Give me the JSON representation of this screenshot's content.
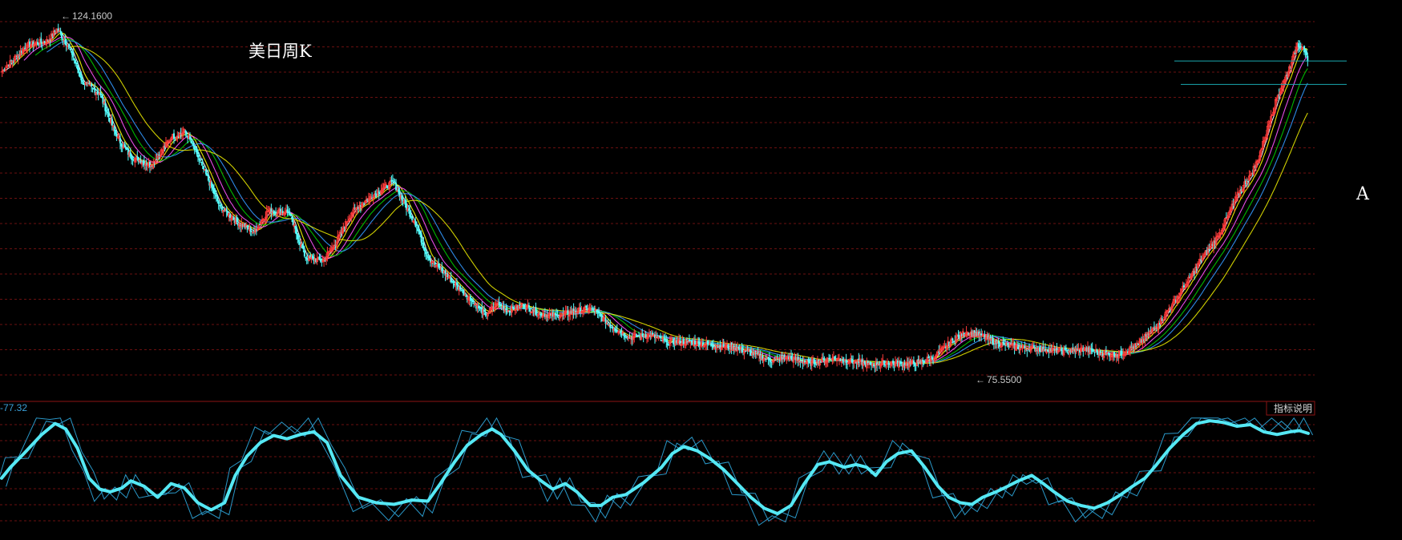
{
  "chart_data": [
    {
      "panel": "price",
      "type": "candlestick",
      "title": "美日周K",
      "ylim": [
        72,
        126
      ],
      "max_label": "124.1600",
      "min_label": "75.5500",
      "marker_label": "A",
      "marker_levels": [
        119.5,
        116.1
      ],
      "candle_up_color": "#ff3b3b",
      "candle_down_color": "#54ffff",
      "ma_colors": [
        "#ffffff",
        "#ffff00",
        "#ff55ff",
        "#00cc00",
        "#3399ff",
        "#e6e600"
      ],
      "path": [
        [
          0,
          118
        ],
        [
          22,
          121.8
        ],
        [
          40,
          122.4
        ],
        [
          48,
          124.16
        ],
        [
          60,
          121
        ],
        [
          70,
          116.5
        ],
        [
          85,
          114.8
        ],
        [
          100,
          108.5
        ],
        [
          112,
          105.7
        ],
        [
          130,
          104.4
        ],
        [
          148,
          108.5
        ],
        [
          160,
          109.3
        ],
        [
          170,
          106
        ],
        [
          190,
          98.5
        ],
        [
          205,
          96.2
        ],
        [
          220,
          94.8
        ],
        [
          232,
          97.8
        ],
        [
          250,
          97.6
        ],
        [
          265,
          91
        ],
        [
          280,
          90.6
        ],
        [
          290,
          92.8
        ],
        [
          298,
          95.3
        ],
        [
          305,
          97.5
        ],
        [
          312,
          98.6
        ],
        [
          320,
          99.6
        ],
        [
          333,
          101.2
        ],
        [
          342,
          101.9
        ],
        [
          350,
          99.2
        ],
        [
          360,
          96.2
        ],
        [
          372,
          91
        ],
        [
          390,
          88.2
        ],
        [
          400,
          86.4
        ],
        [
          410,
          84.8
        ],
        [
          422,
          82.8
        ],
        [
          432,
          84.3
        ],
        [
          442,
          83.4
        ],
        [
          455,
          84.2
        ],
        [
          470,
          82.9
        ],
        [
          485,
          82.6
        ],
        [
          500,
          83.3
        ],
        [
          515,
          83.7
        ],
        [
          530,
          81.3
        ],
        [
          548,
          79.5
        ],
        [
          565,
          79.9
        ],
        [
          580,
          78.8
        ],
        [
          600,
          78.9
        ],
        [
          620,
          78.4
        ],
        [
          640,
          78.1
        ],
        [
          655,
          77.2
        ],
        [
          670,
          76.2
        ],
        [
          685,
          76.6
        ],
        [
          705,
          75.8
        ],
        [
          725,
          76.5
        ],
        [
          740,
          76.1
        ],
        [
          758,
          75.55
        ],
        [
          770,
          75.9
        ],
        [
          785,
          75.7
        ],
        [
          800,
          75.8
        ],
        [
          815,
          76.8
        ],
        [
          830,
          79.1
        ],
        [
          842,
          80.3
        ],
        [
          855,
          79.8
        ],
        [
          870,
          78.6
        ],
        [
          890,
          78
        ],
        [
          910,
          77.8
        ],
        [
          930,
          77.5
        ],
        [
          945,
          77.8
        ],
        [
          960,
          77.2
        ],
        [
          975,
          77
        ],
        [
          992,
          78.5
        ],
        [
          1010,
          81.5
        ],
        [
          1022,
          84.4
        ],
        [
          1035,
          87.5
        ],
        [
          1048,
          91
        ],
        [
          1062,
          94.2
        ],
        [
          1070,
          97
        ],
        [
          1078,
          99.8
        ],
        [
          1084,
          101.5
        ],
        [
          1090,
          103
        ],
        [
          1096,
          105
        ],
        [
          1102,
          108
        ],
        [
          1108,
          111.5
        ],
        [
          1114,
          114.5
        ],
        [
          1120,
          116.8
        ],
        [
          1126,
          119.3
        ],
        [
          1131,
          122
        ],
        [
          1136,
          121.5
        ],
        [
          1140,
          119.4
        ]
      ]
    },
    {
      "panel": "oscillator",
      "type": "line",
      "value_label": "-77.32",
      "button_label": "指标说明",
      "ylim": [
        -110,
        110
      ],
      "main_line_color": "#55e8f4",
      "thin_line_color": "#2a98c8",
      "main_line": [
        [
          0,
          -10
        ],
        [
          10,
          10
        ],
        [
          25,
          35
        ],
        [
          45,
          70
        ],
        [
          60,
          90
        ],
        [
          72,
          80
        ],
        [
          85,
          45
        ],
        [
          98,
          -10
        ],
        [
          110,
          -30
        ],
        [
          122,
          -35
        ],
        [
          135,
          -28
        ],
        [
          145,
          -15
        ],
        [
          160,
          -25
        ],
        [
          175,
          -45
        ],
        [
          190,
          -20
        ],
        [
          205,
          -28
        ],
        [
          220,
          -55
        ],
        [
          235,
          -68
        ],
        [
          250,
          -55
        ],
        [
          262,
          -5
        ],
        [
          275,
          30
        ],
        [
          290,
          55
        ],
        [
          305,
          68
        ],
        [
          320,
          62
        ],
        [
          335,
          70
        ],
        [
          350,
          75
        ],
        [
          365,
          55
        ],
        [
          380,
          -5
        ],
        [
          400,
          -45
        ],
        [
          420,
          -55
        ],
        [
          440,
          -58
        ],
        [
          460,
          -50
        ],
        [
          478,
          -52
        ],
        [
          492,
          -20
        ],
        [
          508,
          20
        ],
        [
          522,
          50
        ],
        [
          538,
          70
        ],
        [
          550,
          80
        ],
        [
          560,
          70
        ],
        [
          575,
          40
        ],
        [
          590,
          5
        ],
        [
          605,
          -15
        ],
        [
          618,
          -30
        ],
        [
          632,
          -20
        ],
        [
          645,
          -35
        ],
        [
          660,
          -60
        ],
        [
          672,
          -60
        ],
        [
          685,
          -45
        ],
        [
          700,
          -40
        ],
        [
          720,
          -18
        ],
        [
          740,
          10
        ],
        [
          752,
          35
        ],
        [
          765,
          48
        ],
        [
          780,
          40
        ],
        [
          795,
          25
        ],
        [
          810,
          5
        ],
        [
          825,
          -20
        ],
        [
          840,
          -45
        ],
        [
          855,
          -65
        ],
        [
          870,
          -75
        ],
        [
          885,
          -60
        ],
        [
          900,
          -20
        ],
        [
          915,
          15
        ],
        [
          928,
          20
        ],
        [
          945,
          10
        ],
        [
          958,
          15
        ],
        [
          970,
          10
        ],
        [
          980,
          -5
        ],
        [
          992,
          20
        ],
        [
          1005,
          35
        ],
        [
          1020,
          40
        ],
        [
          1035,
          10
        ],
        [
          1050,
          -25
        ],
        [
          1062,
          -45
        ],
        [
          1075,
          -55
        ],
        [
          1088,
          -58
        ],
        [
          1100,
          -45
        ],
        [
          1115,
          -35
        ],
        [
          1128,
          -25
        ],
        [
          1140,
          -15
        ],
        [
          1155,
          -5
        ],
        [
          1168,
          -20
        ],
        [
          1180,
          -35
        ],
        [
          1195,
          -52
        ],
        [
          1210,
          -60
        ],
        [
          1225,
          -65
        ],
        [
          1240,
          -55
        ],
        [
          1255,
          -40
        ],
        [
          1268,
          -25
        ],
        [
          1282,
          -10
        ],
        [
          1295,
          15
        ],
        [
          1310,
          45
        ],
        [
          1325,
          70
        ],
        [
          1340,
          90
        ],
        [
          1355,
          95
        ],
        [
          1370,
          92
        ],
        [
          1385,
          85
        ],
        [
          1400,
          88
        ],
        [
          1415,
          75
        ],
        [
          1430,
          70
        ],
        [
          1445,
          75
        ],
        [
          1455,
          77
        ],
        [
          1465,
          72
        ]
      ]
    }
  ]
}
